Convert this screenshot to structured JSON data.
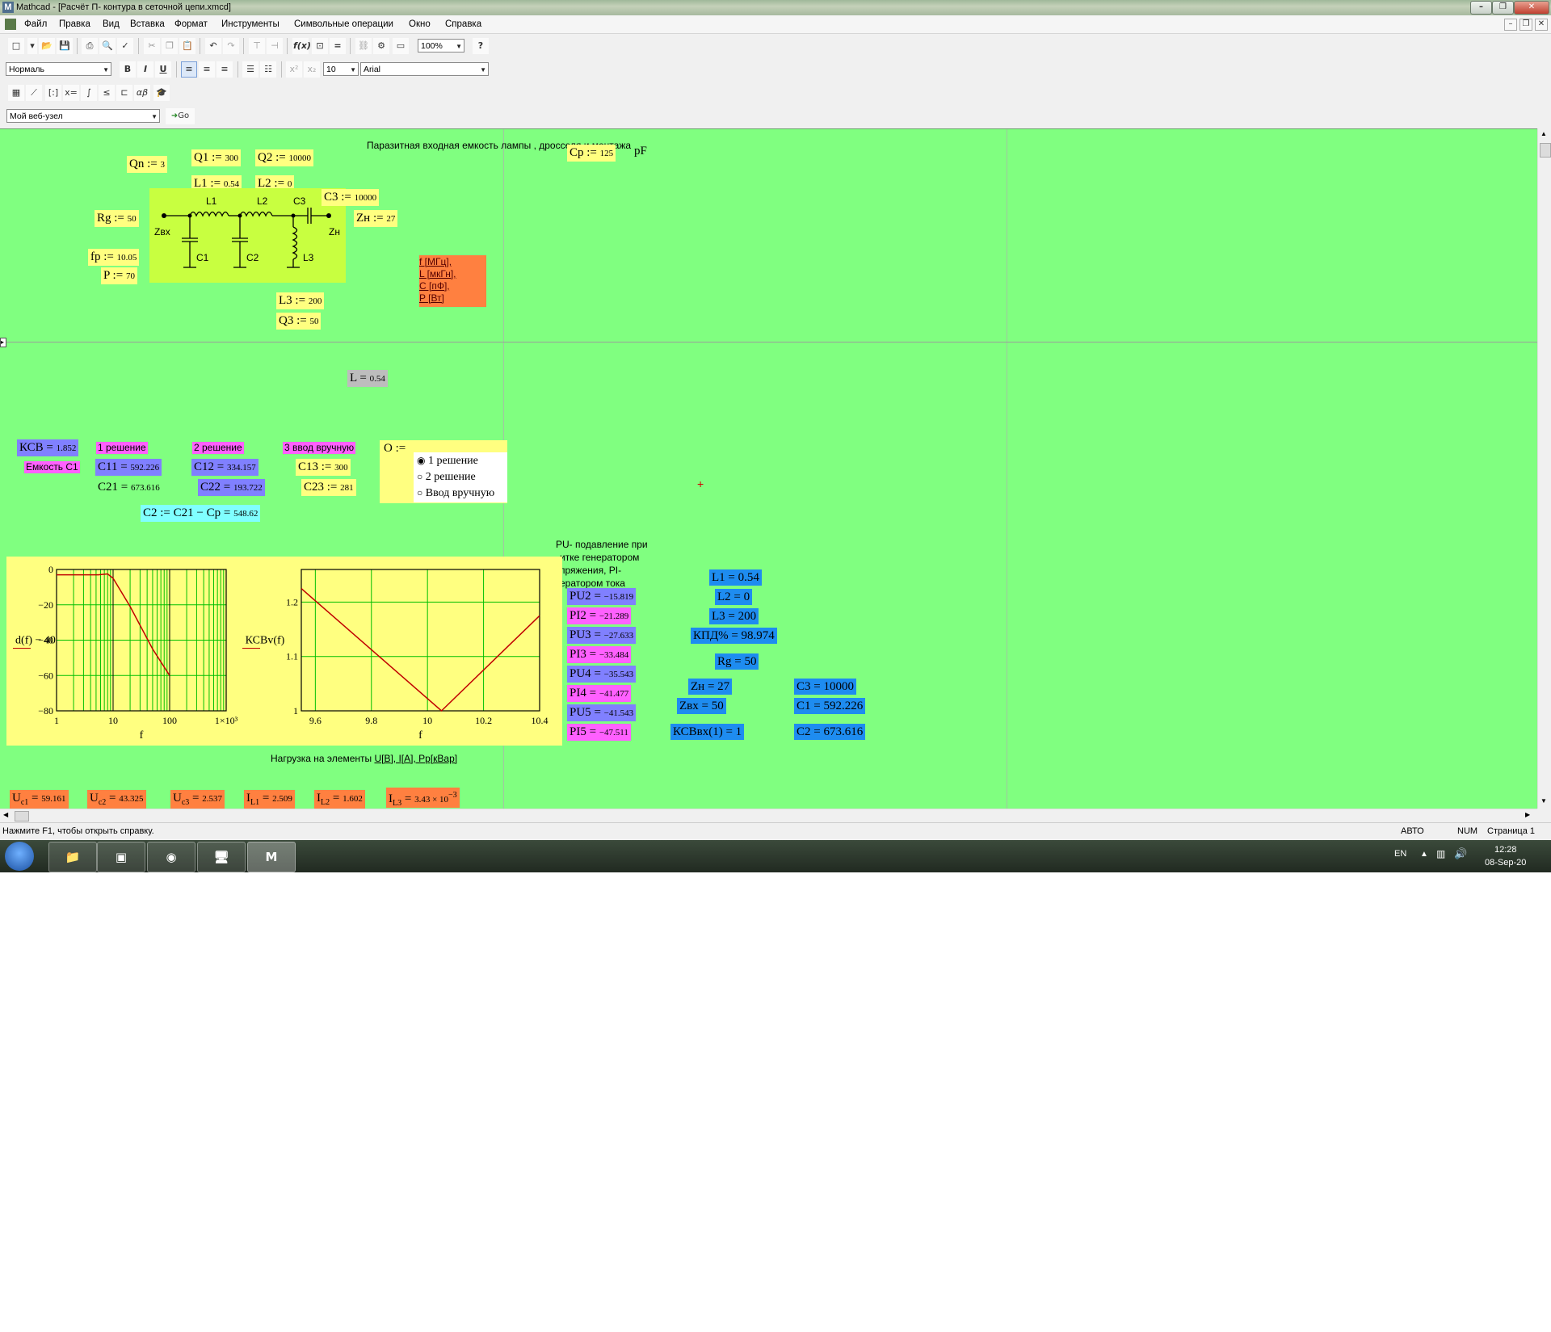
{
  "window": {
    "title": "Mathcad - [Расчёт П- контура в сеточной цепи.xmcd]",
    "controls": {
      "minimize": "–",
      "restore": "❐",
      "close": "✕"
    }
  },
  "menu": [
    "Файл",
    "Правка",
    "Вид",
    "Вставка",
    "Формат",
    "Инструменты",
    "Символьные операции",
    "Окно",
    "Справка"
  ],
  "toolbar": {
    "zoom": "100%",
    "style": "Нормаль",
    "font_size": "10",
    "font": "Arial",
    "bold": "B",
    "italic": "I",
    "underline": "U",
    "web_address": "Мой веб-узел",
    "go": "Go"
  },
  "worksheet": {
    "header_note": "Паразитная входная емкость лампы , дросселя и монтажа",
    "cp_unit": "pF",
    "units_note": [
      "f [МГц],",
      "L [мкГн],",
      "С [пФ],",
      "P [Вт]"
    ],
    "inputs": {
      "qn": {
        "name": "Qn",
        "op": ":=",
        "val": "3"
      },
      "q1": {
        "name": "Q1",
        "op": ":=",
        "val": "300"
      },
      "q2": {
        "name": "Q2",
        "op": ":=",
        "val": "10000"
      },
      "l1": {
        "name": "L1",
        "op": ":=",
        "val": "0.54"
      },
      "l2": {
        "name": "L2",
        "op": ":=",
        "val": "0"
      },
      "c3": {
        "name": "C3",
        "op": ":=",
        "val": "10000"
      },
      "rg": {
        "name": "Rg",
        "op": ":=",
        "val": "50"
      },
      "zn": {
        "name": "Zн",
        "op": ":=",
        "val": "27"
      },
      "fp": {
        "name": "fp",
        "op": ":=",
        "val": "10.05"
      },
      "p": {
        "name": "P",
        "op": ":=",
        "val": "70"
      },
      "l3": {
        "name": "L3",
        "op": ":=",
        "val": "200"
      },
      "q3": {
        "name": "Q3",
        "op": ":=",
        "val": "50"
      },
      "cp": {
        "name": "Cp",
        "op": ":=",
        "val": "125"
      }
    },
    "schematic_labels": {
      "l1": "L1",
      "l2": "L2",
      "c3": "C3",
      "zvx": "Zвх",
      "zn": "Zн",
      "c1": "C1",
      "c2": "C2",
      "l3": "L3"
    },
    "l_result": {
      "name": "L",
      "op": "=",
      "val": "0.54"
    },
    "ksv": {
      "name": "КСВ",
      "op": "=",
      "val": "1.852"
    },
    "emkost_c1": "Емкость С1",
    "sol1": "1 решение",
    "sol2": "2 решение",
    "sol3": "3 ввод вручную",
    "c11": {
      "name": "C11",
      "op": "=",
      "val": "592.226"
    },
    "c12": {
      "name": "C12",
      "op": "=",
      "val": "334.157"
    },
    "c13": {
      "name": "C13",
      "op": ":=",
      "val": "300"
    },
    "c21": {
      "name": "C21",
      "op": "=",
      "val": "673.616"
    },
    "c22": {
      "name": "C22",
      "op": "=",
      "val": "193.722"
    },
    "c23": {
      "name": "C23",
      "op": ":=",
      "val": "281"
    },
    "o_label": "O :=",
    "radio": [
      "1 решение",
      "2 решение",
      "Ввод вручную"
    ],
    "c2_expr": {
      "text": "C2 := C21 − Cp =",
      "val": "548.62"
    },
    "pu_note": [
      "PU- подавление при",
      "итке генератором",
      "пряжения, PI-",
      "ератором тока"
    ],
    "pu_rows": [
      {
        "name": "PU2",
        "val": "−15.819"
      },
      {
        "name": "PI2",
        "val": "−21.289"
      },
      {
        "name": "PU3",
        "val": "−27.633"
      },
      {
        "name": "PI3",
        "val": "−33.484"
      },
      {
        "name": "PU4",
        "val": "−35.543"
      },
      {
        "name": "PI4",
        "val": "−41.477"
      },
      {
        "name": "PU5",
        "val": "−41.543"
      },
      {
        "name": "PI5",
        "val": "−47.511"
      }
    ],
    "summary": {
      "l1": "L1 = 0.54",
      "l2": "L2 = 0",
      "l3": "L3 = 200",
      "kpd": "КПД% = 98.974",
      "rg": "Rg = 50",
      "zn": "Zн = 27",
      "zvx": "Zвх = 50",
      "ksvvx": "КСВвх(1) = 1",
      "c3": "C3 = 10000",
      "c1": "C1 = 592.226",
      "c2": "C2 = 673.616"
    },
    "load_note_prefix": "Нагрузка на элементы ",
    "load_note_link": "U[B], I[A], Pp[кВар]",
    "loads": [
      {
        "name": "U",
        "sub": "c1",
        "val": "59.161"
      },
      {
        "name": "U",
        "sub": "c2",
        "val": "43.325"
      },
      {
        "name": "U",
        "sub": "c3",
        "val": "2.537"
      },
      {
        "name": "I",
        "sub": "L1",
        "val": "2.509"
      },
      {
        "name": "I",
        "sub": "L2",
        "val": "1.602"
      },
      {
        "name": "I",
        "sub": "L3",
        "val": "3.43 × 10",
        "exp": "−3"
      }
    ]
  },
  "chart_data": [
    {
      "type": "line",
      "x_scale": "log",
      "ylabel": "d(f) − 40",
      "xlabel": "f",
      "xlim": [
        1,
        1000
      ],
      "ylim": [
        -80,
        0
      ],
      "x_ticks": [
        "1",
        "10",
        "100",
        "1×10³"
      ],
      "y_ticks": [
        "0",
        "−20",
        "−40",
        "−60",
        "−80"
      ],
      "series": [
        {
          "points": [
            [
              1,
              -3
            ],
            [
              5.5,
              -3
            ],
            [
              8,
              -2.5
            ],
            [
              10,
              -5
            ],
            [
              20,
              -21
            ],
            [
              50,
              -45
            ],
            [
              100,
              -60
            ]
          ]
        }
      ]
    },
    {
      "type": "line",
      "ylabel": "КСВv(f)",
      "xlabel": "f",
      "xlim": [
        9.55,
        10.4
      ],
      "ylim": [
        1.0,
        1.26
      ],
      "x_ticks": [
        "9.6",
        "9.8",
        "10",
        "10.2",
        "10.4"
      ],
      "y_ticks": [
        "1.2",
        "1.1",
        "1"
      ],
      "series": [
        {
          "points": [
            [
              9.55,
              1.225
            ],
            [
              10.05,
              1.0
            ],
            [
              10.4,
              1.175
            ]
          ]
        }
      ]
    }
  ],
  "status": {
    "help": "Нажмите F1, чтобы открыть справку.",
    "mode": "АВТО",
    "num": "NUM",
    "page": "Страница 1"
  },
  "taskbar": {
    "lang": "EN",
    "time": "12:28",
    "date": "08-Sep-20"
  },
  "colors": {
    "worksheet": "#80ff80",
    "math_input": "#ffff80",
    "result_blue": "#8080ff",
    "result_darkblue": "#1e8cf0",
    "result_magenta": "#ff60ff",
    "result_orange": "#ff8040",
    "plot_line": "#c00000",
    "plot_grid": "#00c000"
  }
}
